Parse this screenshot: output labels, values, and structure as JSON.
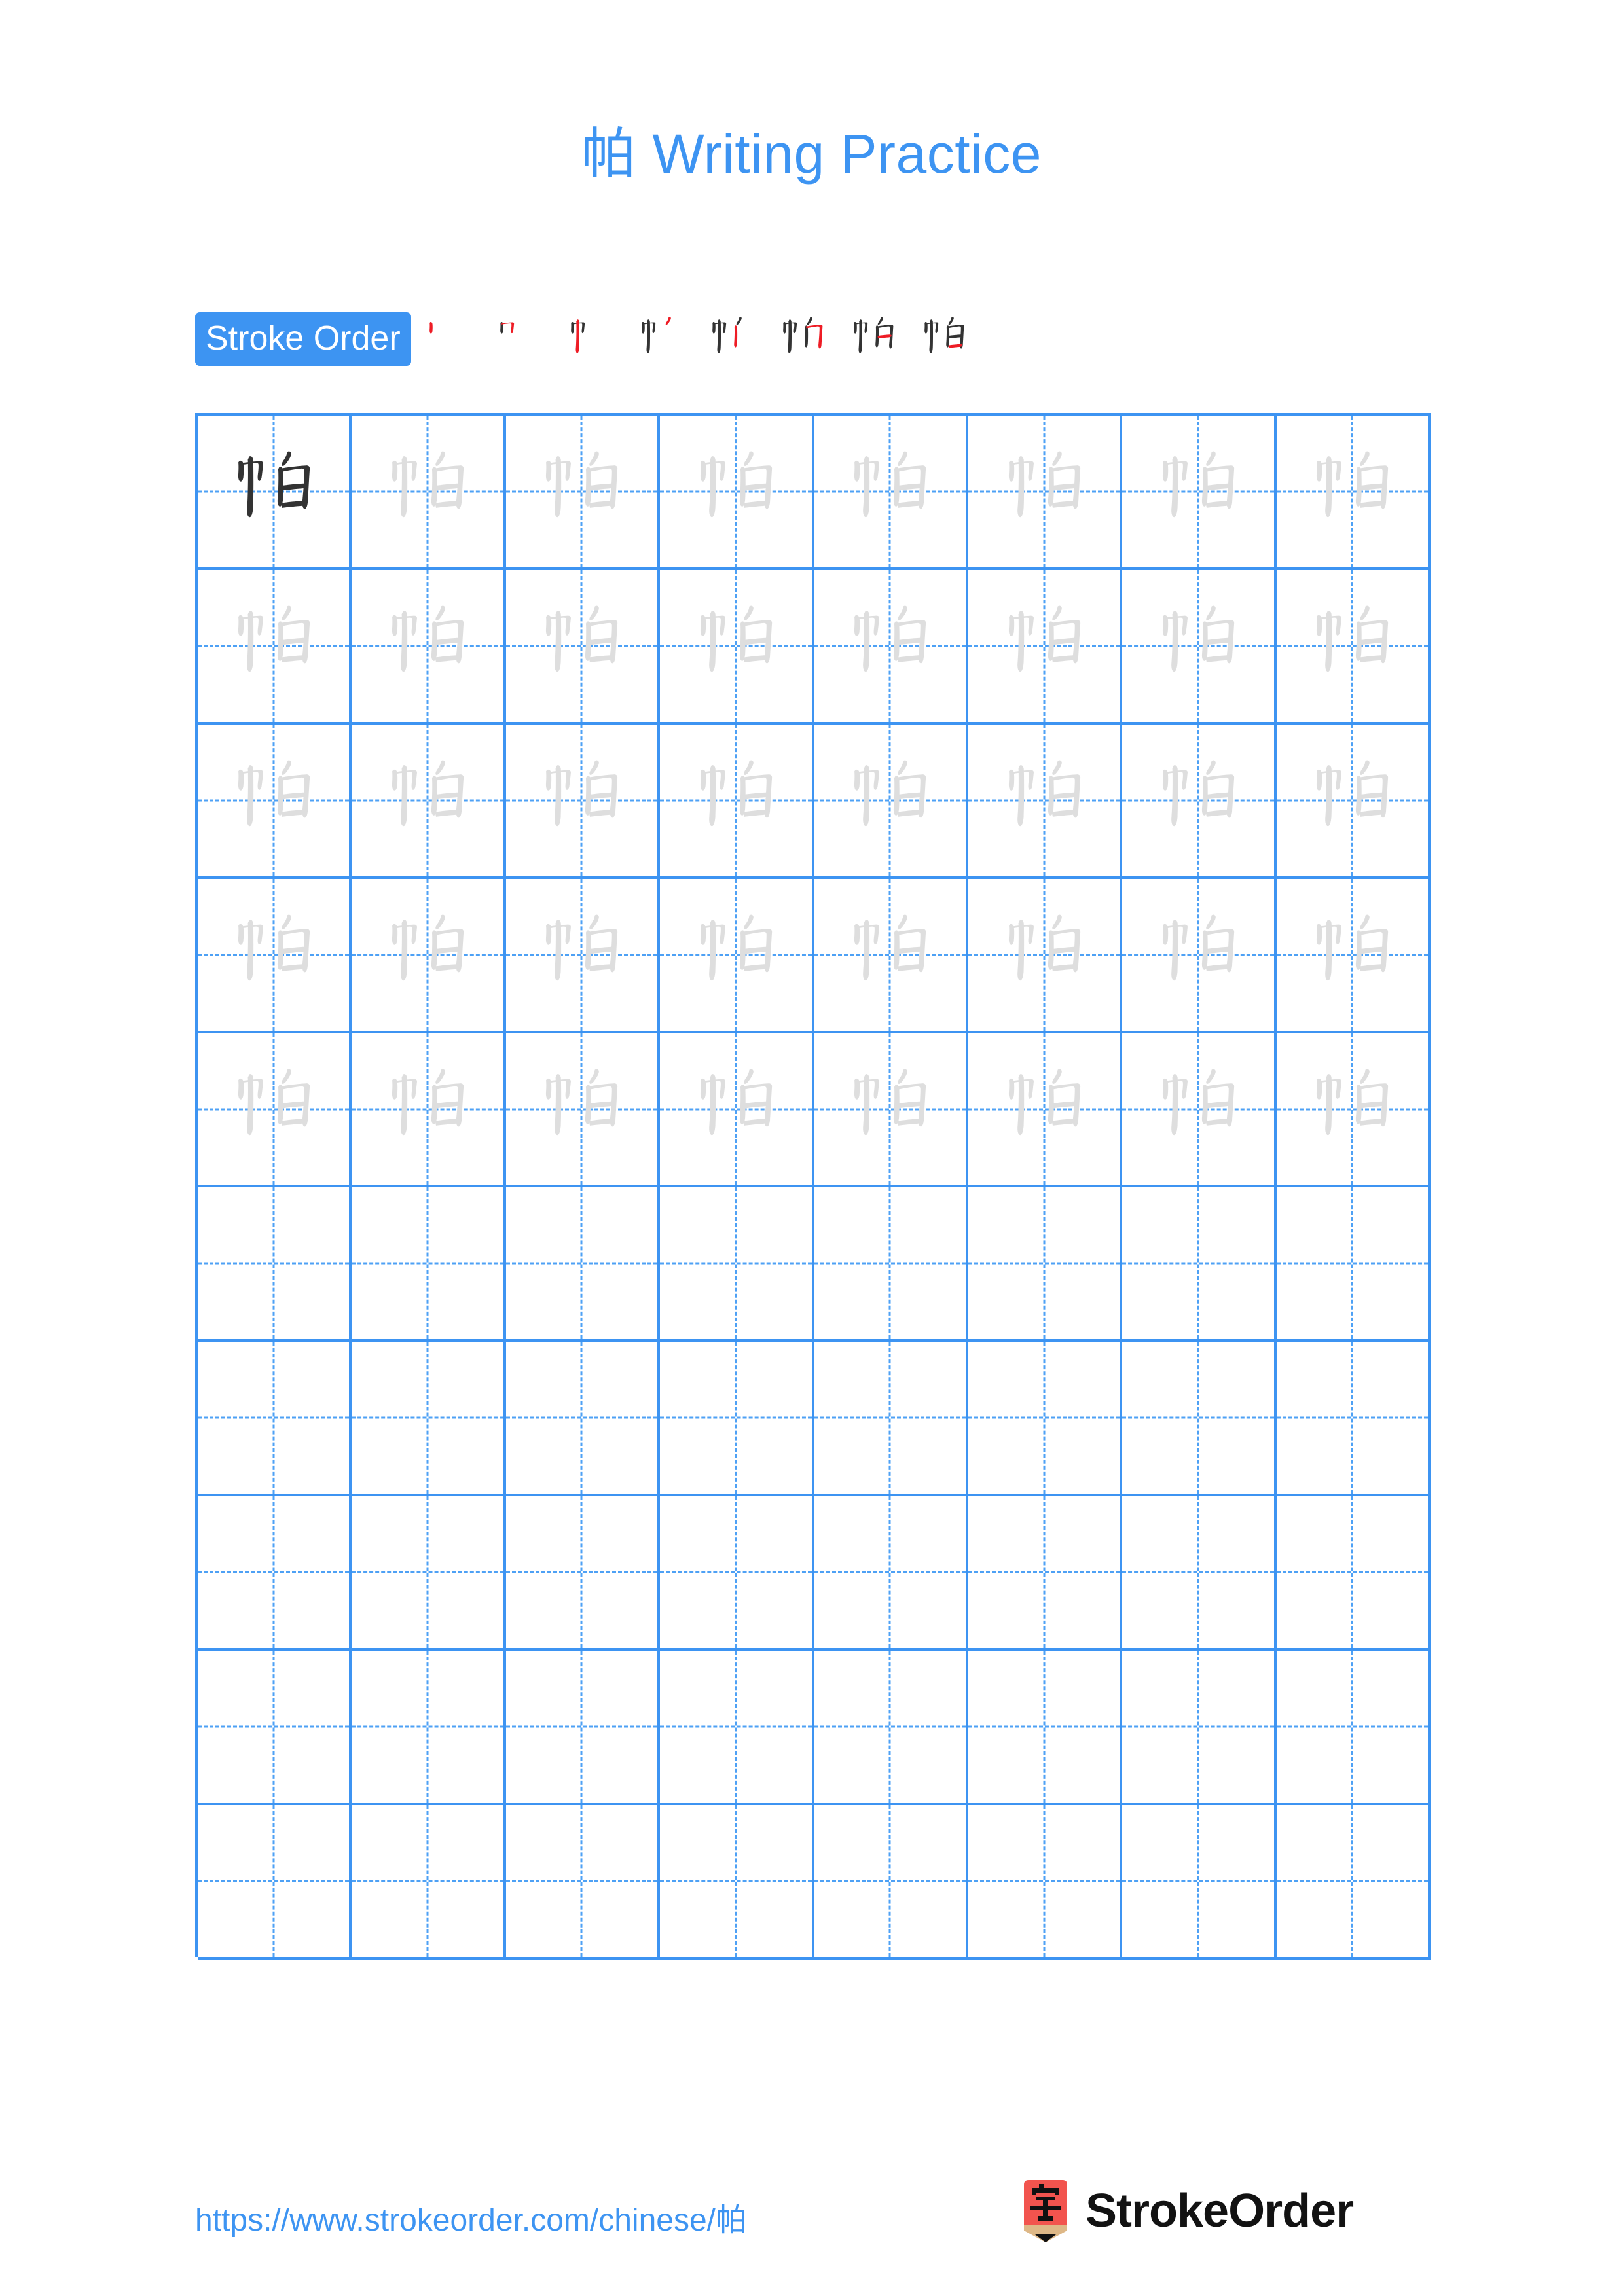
{
  "document": {
    "character": "帕",
    "title": "帕 Writing Practice",
    "accent_color": "#3d94f2",
    "ink_color": "#333333",
    "trace_color": "#dedede",
    "new_stroke_color": "#ee1c25",
    "background": "#ffffff"
  },
  "stroke_order": {
    "badge_label": "Stroke Order",
    "total_strokes": 8,
    "steps": [
      {
        "index": 1,
        "label": "stroke-step-1",
        "strokes_shown": 1
      },
      {
        "index": 2,
        "label": "stroke-step-2",
        "strokes_shown": 2
      },
      {
        "index": 3,
        "label": "stroke-step-3",
        "strokes_shown": 3
      },
      {
        "index": 4,
        "label": "stroke-step-4",
        "strokes_shown": 4
      },
      {
        "index": 5,
        "label": "stroke-step-5",
        "strokes_shown": 5
      },
      {
        "index": 6,
        "label": "stroke-step-6",
        "strokes_shown": 6
      },
      {
        "index": 7,
        "label": "stroke-step-7",
        "strokes_shown": 7
      },
      {
        "index": 8,
        "label": "stroke-step-8",
        "strokes_shown": 8
      }
    ]
  },
  "practice_grid": {
    "columns": 8,
    "rows": 10,
    "grid_line_color": "#3d94f2",
    "guide_line_style": "dashed-cross",
    "rows_data": [
      {
        "row": 1,
        "cells": [
          "solid",
          "trace",
          "trace",
          "trace",
          "trace",
          "trace",
          "trace",
          "trace"
        ]
      },
      {
        "row": 2,
        "cells": [
          "trace",
          "trace",
          "trace",
          "trace",
          "trace",
          "trace",
          "trace",
          "trace"
        ]
      },
      {
        "row": 3,
        "cells": [
          "trace",
          "trace",
          "trace",
          "trace",
          "trace",
          "trace",
          "trace",
          "trace"
        ]
      },
      {
        "row": 4,
        "cells": [
          "trace",
          "trace",
          "trace",
          "trace",
          "trace",
          "trace",
          "trace",
          "trace"
        ]
      },
      {
        "row": 5,
        "cells": [
          "trace",
          "trace",
          "trace",
          "trace",
          "trace",
          "trace",
          "trace",
          "trace"
        ]
      },
      {
        "row": 6,
        "cells": [
          "empty",
          "empty",
          "empty",
          "empty",
          "empty",
          "empty",
          "empty",
          "empty"
        ]
      },
      {
        "row": 7,
        "cells": [
          "empty",
          "empty",
          "empty",
          "empty",
          "empty",
          "empty",
          "empty",
          "empty"
        ]
      },
      {
        "row": 8,
        "cells": [
          "empty",
          "empty",
          "empty",
          "empty",
          "empty",
          "empty",
          "empty",
          "empty"
        ]
      },
      {
        "row": 9,
        "cells": [
          "empty",
          "empty",
          "empty",
          "empty",
          "empty",
          "empty",
          "empty",
          "empty"
        ]
      },
      {
        "row": 10,
        "cells": [
          "empty",
          "empty",
          "empty",
          "empty",
          "empty",
          "empty",
          "empty",
          "empty"
        ]
      }
    ]
  },
  "footer": {
    "url": "https://www.strokeorder.com/chinese/帕",
    "brand_name": "StrokeOrder",
    "logo_character": "字",
    "logo_color": "#f2544e"
  }
}
